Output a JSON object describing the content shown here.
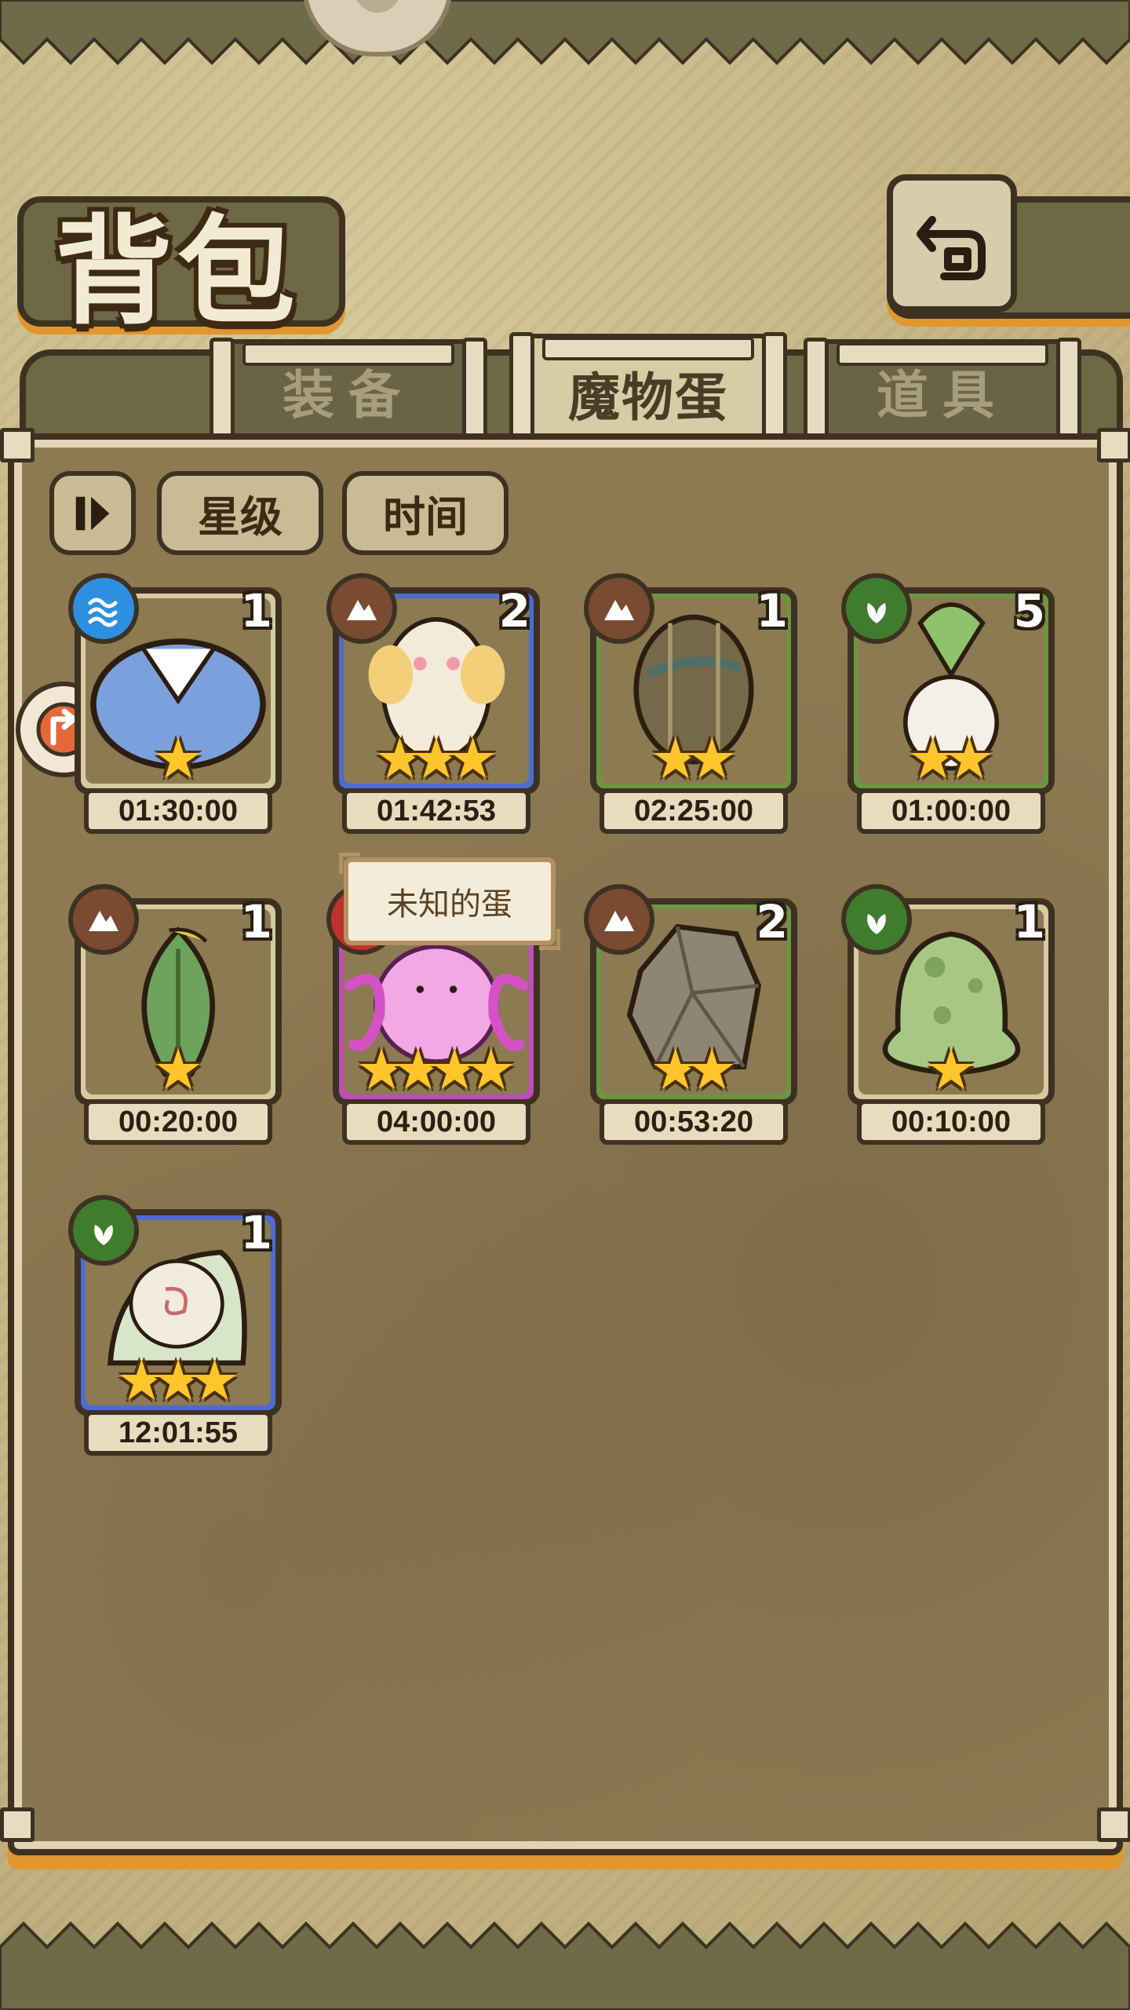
{
  "header": {
    "title": "背包"
  },
  "tabs": [
    {
      "label": "装备",
      "active": false
    },
    {
      "label": "魔物蛋",
      "active": true
    },
    {
      "label": "道具",
      "active": false
    }
  ],
  "sort": {
    "icon": "pause-sort-icon",
    "star_label": "星级",
    "time_label": "时间"
  },
  "tooltip": {
    "text": "未知的蛋"
  },
  "colors": {
    "water": "#2d8fe0",
    "earth": "#7a4a33",
    "wood": "#3f7c2d",
    "fire": "#c0302b",
    "star": "#ffc52a",
    "accent": "#e2962e"
  },
  "eggs": [
    {
      "element": "water",
      "count": "1",
      "stars": 1,
      "frame": "tan",
      "timer": "01:30:00"
    },
    {
      "element": "earth",
      "count": "2",
      "stars": 3,
      "frame": "blue",
      "timer": "01:42:53"
    },
    {
      "element": "earth",
      "count": "1",
      "stars": 2,
      "frame": "green",
      "timer": "02:25:00"
    },
    {
      "element": "wood",
      "count": "5",
      "stars": 2,
      "frame": "green",
      "timer": "01:00:00"
    },
    {
      "element": "earth",
      "count": "1",
      "stars": 1,
      "frame": "tan",
      "timer": "00:20:00"
    },
    {
      "element": "fire",
      "count": "",
      "stars": 4,
      "frame": "pink",
      "timer": "04:00:00"
    },
    {
      "element": "earth",
      "count": "2",
      "stars": 2,
      "frame": "green",
      "timer": "00:53:20"
    },
    {
      "element": "wood",
      "count": "1",
      "stars": 1,
      "frame": "tan",
      "timer": "00:10:00"
    },
    {
      "element": "wood",
      "count": "1",
      "stars": 3,
      "frame": "blue",
      "timer": "12:01:55"
    }
  ]
}
